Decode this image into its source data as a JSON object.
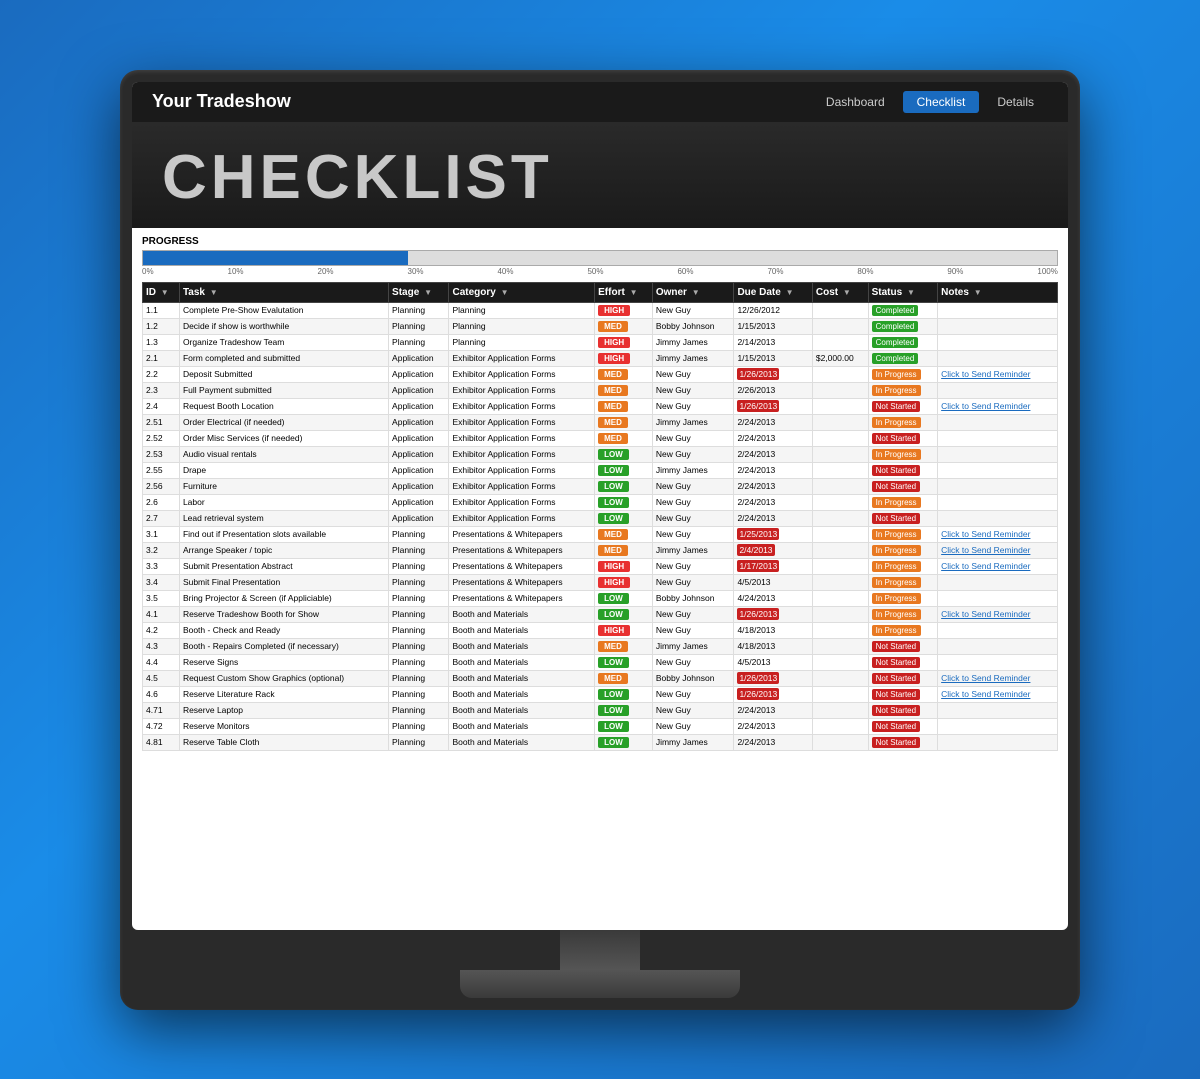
{
  "app": {
    "title": "Your Tradeshow",
    "nav": [
      "Dashboard",
      "Checklist",
      "Details"
    ],
    "active_nav": "Checklist"
  },
  "page": {
    "heading": "CHECKLIST"
  },
  "progress": {
    "label": "PROGRESS",
    "fill_pct": 29,
    "markers": [
      "0%",
      "10%",
      "20%",
      "30%",
      "40%",
      "50%",
      "60%",
      "70%",
      "80%",
      "90%",
      "100%"
    ]
  },
  "table": {
    "headers": [
      "ID",
      "Task",
      "Stage",
      "Category",
      "Effort",
      "Owner",
      "Due Date",
      "Cost",
      "Status",
      "Notes"
    ],
    "rows": [
      [
        "1.1",
        "Complete Pre-Show Evalutation",
        "Planning",
        "Planning",
        "HIGH",
        "New Guy",
        "12/26/2012",
        "",
        "Completed",
        ""
      ],
      [
        "1.2",
        "Decide if show is worthwhile",
        "Planning",
        "Planning",
        "MED",
        "Bobby Johnson",
        "1/15/2013",
        "",
        "Completed",
        ""
      ],
      [
        "1.3",
        "Organize Tradeshow Team",
        "Planning",
        "Planning",
        "HIGH",
        "Jimmy James",
        "2/14/2013",
        "",
        "Completed",
        ""
      ],
      [
        "2.1",
        "Form completed and submitted",
        "Application",
        "Exhibitor Application Forms",
        "HIGH",
        "Jimmy James",
        "1/15/2013",
        "$2,000.00",
        "Completed",
        ""
      ],
      [
        "2.2",
        "Deposit Submitted",
        "Application",
        "Exhibitor Application Forms",
        "MED",
        "New Guy",
        "1/26/2013",
        "",
        "In Progress",
        "Click to Send Reminder"
      ],
      [
        "2.3",
        "Full Payment submitted",
        "Application",
        "Exhibitor Application Forms",
        "MED",
        "New Guy",
        "2/26/2013",
        "",
        "In Progress",
        ""
      ],
      [
        "2.4",
        "Request Booth Location",
        "Application",
        "Exhibitor Application Forms",
        "MED",
        "New Guy",
        "1/26/2013",
        "",
        "Not Started",
        "Click to Send Reminder"
      ],
      [
        "2.51",
        "Order Electrical (if needed)",
        "Application",
        "Exhibitor Application Forms",
        "MED",
        "Jimmy James",
        "2/24/2013",
        "",
        "In Progress",
        ""
      ],
      [
        "2.52",
        "Order Misc Services (if needed)",
        "Application",
        "Exhibitor Application Forms",
        "MED",
        "New Guy",
        "2/24/2013",
        "",
        "Not Started",
        ""
      ],
      [
        "2.53",
        "Audio visual rentals",
        "Application",
        "Exhibitor Application Forms",
        "LOW",
        "New Guy",
        "2/24/2013",
        "",
        "In Progress",
        ""
      ],
      [
        "2.55",
        "Drape",
        "Application",
        "Exhibitor Application Forms",
        "LOW",
        "Jimmy James",
        "2/24/2013",
        "",
        "Not Started",
        ""
      ],
      [
        "2.56",
        "Furniture",
        "Application",
        "Exhibitor Application Forms",
        "LOW",
        "New Guy",
        "2/24/2013",
        "",
        "Not Started",
        ""
      ],
      [
        "2.6",
        "Labor",
        "Application",
        "Exhibitor Application Forms",
        "LOW",
        "New Guy",
        "2/24/2013",
        "",
        "In Progress",
        ""
      ],
      [
        "2.7",
        "Lead retrieval system",
        "Application",
        "Exhibitor Application Forms",
        "LOW",
        "New Guy",
        "2/24/2013",
        "",
        "Not Started",
        ""
      ],
      [
        "3.1",
        "Find out if Presentation slots available",
        "Planning",
        "Presentations & Whitepapers",
        "MED",
        "New Guy",
        "1/25/2013",
        "",
        "In Progress",
        "Click to Send Reminder"
      ],
      [
        "3.2",
        "Arrange Speaker / topic",
        "Planning",
        "Presentations & Whitepapers",
        "MED",
        "Jimmy James",
        "2/4/2013",
        "",
        "In Progress",
        "Click to Send Reminder"
      ],
      [
        "3.3",
        "Submit Presentation Abstract",
        "Planning",
        "Presentations & Whitepapers",
        "HIGH",
        "New Guy",
        "1/17/2013",
        "",
        "In Progress",
        "Click to Send Reminder"
      ],
      [
        "3.4",
        "Submit Final Presentation",
        "Planning",
        "Presentations & Whitepapers",
        "HIGH",
        "New Guy",
        "4/5/2013",
        "",
        "In Progress",
        ""
      ],
      [
        "3.5",
        "Bring Projector & Screen (if Appliciable)",
        "Planning",
        "Presentations & Whitepapers",
        "LOW",
        "Bobby Johnson",
        "4/24/2013",
        "",
        "In Progress",
        ""
      ],
      [
        "4.1",
        "Reserve Tradeshow Booth for Show",
        "Planning",
        "Booth and Materials",
        "LOW",
        "New Guy",
        "1/26/2013",
        "",
        "In Progress",
        "Click to Send Reminder"
      ],
      [
        "4.2",
        "Booth - Check and Ready",
        "Planning",
        "Booth and Materials",
        "HIGH",
        "New Guy",
        "4/18/2013",
        "",
        "In Progress",
        ""
      ],
      [
        "4.3",
        "Booth - Repairs Completed (if necessary)",
        "Planning",
        "Booth and Materials",
        "MED",
        "Jimmy James",
        "4/18/2013",
        "",
        "Not Started",
        ""
      ],
      [
        "4.4",
        "Reserve Signs",
        "Planning",
        "Booth and Materials",
        "LOW",
        "New Guy",
        "4/5/2013",
        "",
        "Not Started",
        ""
      ],
      [
        "4.5",
        "Request Custom Show Graphics (optional)",
        "Planning",
        "Booth and Materials",
        "MED",
        "Bobby Johnson",
        "1/26/2013",
        "",
        "Not Started",
        "Click to Send Reminder"
      ],
      [
        "4.6",
        "Reserve Literature Rack",
        "Planning",
        "Booth and Materials",
        "LOW",
        "New Guy",
        "1/26/2013",
        "",
        "Not Started",
        "Click to Send Reminder"
      ],
      [
        "4.71",
        "Reserve Laptop",
        "Planning",
        "Booth and Materials",
        "LOW",
        "New Guy",
        "2/24/2013",
        "",
        "Not Started",
        ""
      ],
      [
        "4.72",
        "Reserve Monitors",
        "Planning",
        "Booth and Materials",
        "LOW",
        "New Guy",
        "2/24/2013",
        "",
        "Not Started",
        ""
      ],
      [
        "4.81",
        "Reserve Table Cloth",
        "Planning",
        "Booth and Materials",
        "LOW",
        "Jimmy James",
        "2/24/2013",
        "",
        "Not Started",
        ""
      ]
    ]
  },
  "overdue_dates": [
    "1/26/2013",
    "1/26/2013",
    "1/25/2013",
    "2/4/2013",
    "1/17/2013",
    "1/26/2013",
    "1/26/2013",
    "1/26/2013"
  ],
  "colors": {
    "blue": "#1a6bbf",
    "header_bg": "#1a1a1a",
    "completed": "#28a028",
    "in_progress": "#e87820",
    "not_started": "#c82020",
    "high": "#e83030",
    "med": "#e87820",
    "low": "#28a028"
  }
}
